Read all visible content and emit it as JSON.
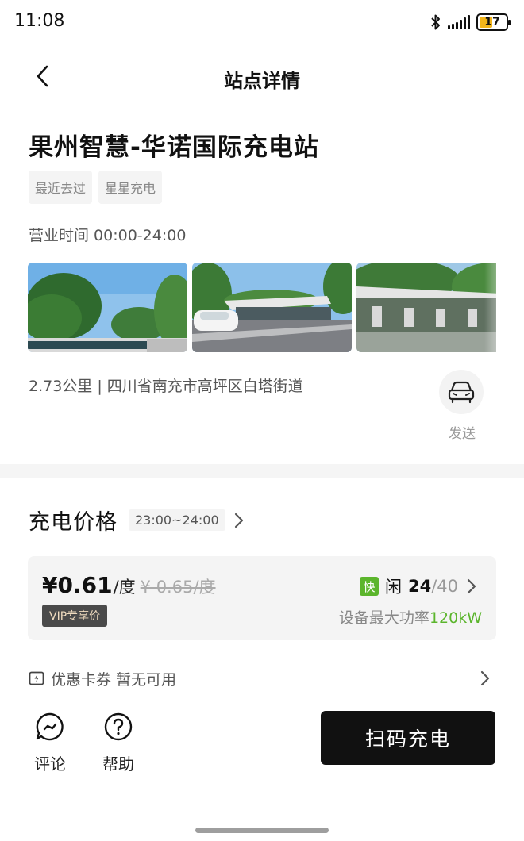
{
  "status_bar": {
    "time": "11:08",
    "battery": "17",
    "icons": [
      "bluetooth-icon",
      "signal-icon",
      "battery-icon"
    ]
  },
  "nav": {
    "title": "站点详情",
    "back_icon": "chevron-left-icon"
  },
  "station": {
    "name": "果州智慧-华诺国际充电站",
    "tags": [
      "最近去过",
      "星星充电"
    ],
    "hours": "营业时间 00:00-24:00",
    "photos": [
      "station-photo-trees",
      "station-photo-canopy-car",
      "station-photo-canopy-chargers"
    ],
    "address": "2.73公里 | 四川省南充市高坪区白塔街道",
    "send_label": "发送",
    "send_icon": "car-icon"
  },
  "price": {
    "title": "充电价格",
    "time_range": "23:00~24:00",
    "current_price": "¥0.61",
    "unit": "/度",
    "original_price": "¥ 0.65/度",
    "vip_label": "VIP专享价",
    "fast_badge": "快",
    "idle_label": "闲",
    "idle_count": "24",
    "total_count": "/40",
    "power_label": "设备最大功率",
    "power_value": "120kW"
  },
  "coupon": {
    "label": "优惠卡券",
    "status": "暂无可用",
    "icon": "lightning-card-icon"
  },
  "actions": {
    "comment_label": "评论",
    "help_label": "帮助",
    "scan_label": "扫码充电"
  },
  "colors": {
    "accent_green": "#5bb52c",
    "primary_button": "#111111",
    "battery_yellow": "#f3b51a"
  }
}
